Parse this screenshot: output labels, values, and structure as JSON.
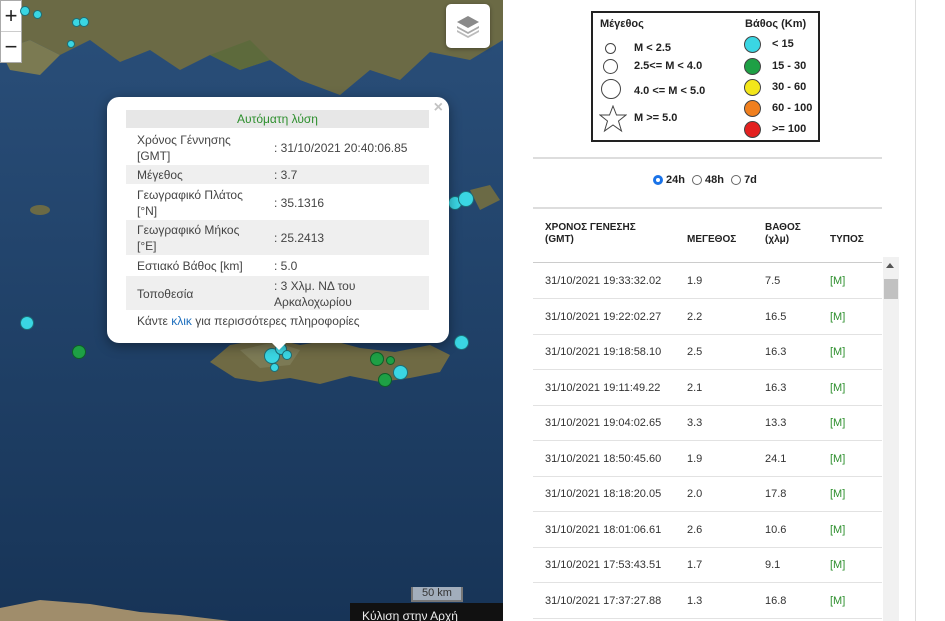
{
  "map": {
    "zoom_in": "+",
    "zoom_out": "−",
    "scale_label": "50 km",
    "caption": "Κύλιση στην Αρχή",
    "popup": {
      "title": "Αυτόματη λύση",
      "close": "×",
      "rows": [
        {
          "key": "Χρόνος Γέννησης [GMT]",
          "value": ": 31/10/2021 20:40:06.85"
        },
        {
          "key": "Μέγεθος",
          "value": ": 3.7"
        },
        {
          "key": "Γεωγραφικό Πλάτος [°N]",
          "value": ": 35.1316"
        },
        {
          "key": "Γεωγραφικό Μήκος [°E]",
          "value": ": 25.2413"
        },
        {
          "key": "Εστιακό Βάθος [km]",
          "value": ": 5.0"
        },
        {
          "key": "Τοποθεσία",
          "value": ": 3 Χλμ. ΝΔ του Αρκαλοχωρίου"
        }
      ],
      "more_prefix": "Κάντε ",
      "more_link": "κλικ",
      "more_suffix": " για περισσότερες πληροφορίες"
    }
  },
  "legend": {
    "magnitude_title": "Μέγεθος",
    "depth_title": "Βάθος (Km)",
    "magnitudes": [
      "M < 2.5",
      "2.5<= M < 4.0",
      "4.0 <= M < 5.0",
      "M >= 5.0"
    ],
    "depths": [
      {
        "label": "< 15",
        "color": "#3ad6e3"
      },
      {
        "label": "15 - 30",
        "color": "#1ea045"
      },
      {
        "label": "30 - 60",
        "color": "#f3e61a"
      },
      {
        "label": "60 - 100",
        "color": "#f07f1e"
      },
      {
        "label": ">= 100",
        "color": "#e3201f"
      }
    ]
  },
  "filters": {
    "options": [
      "24h",
      "48h",
      "7d"
    ],
    "selected": "24h"
  },
  "table": {
    "headers": {
      "time_line1": "ΧΡΟΝΟΣ ΓΕΝΕΣΗΣ",
      "time_line2": "(GMT)",
      "magnitude": "ΜΕΓΕΘΟΣ",
      "depth_line1": "ΒΑΘΟΣ",
      "depth_line2": "(χλμ)",
      "type": "ΤΥΠΟΣ"
    },
    "rows": [
      {
        "time": "31/10/2021 19:33:32.02",
        "mag": "1.9",
        "depth": "7.5",
        "type": "[M]"
      },
      {
        "time": "31/10/2021 19:22:02.27",
        "mag": "2.2",
        "depth": "16.5",
        "type": "[M]"
      },
      {
        "time": "31/10/2021 19:18:58.10",
        "mag": "2.5",
        "depth": "16.3",
        "type": "[M]"
      },
      {
        "time": "31/10/2021 19:11:49.22",
        "mag": "2.1",
        "depth": "16.3",
        "type": "[M]"
      },
      {
        "time": "31/10/2021 19:04:02.65",
        "mag": "3.3",
        "depth": "13.3",
        "type": "[M]"
      },
      {
        "time": "31/10/2021 18:50:45.60",
        "mag": "1.9",
        "depth": "24.1",
        "type": "[M]"
      },
      {
        "time": "31/10/2021 18:18:20.05",
        "mag": "2.0",
        "depth": "17.8",
        "type": "[M]"
      },
      {
        "time": "31/10/2021 18:01:06.61",
        "mag": "2.6",
        "depth": "10.6",
        "type": "[M]"
      },
      {
        "time": "31/10/2021 17:53:43.51",
        "mag": "1.7",
        "depth": "9.1",
        "type": "[M]"
      },
      {
        "time": "31/10/2021 17:37:27.88",
        "mag": "1.3",
        "depth": "16.8",
        "type": "[M]"
      }
    ]
  }
}
